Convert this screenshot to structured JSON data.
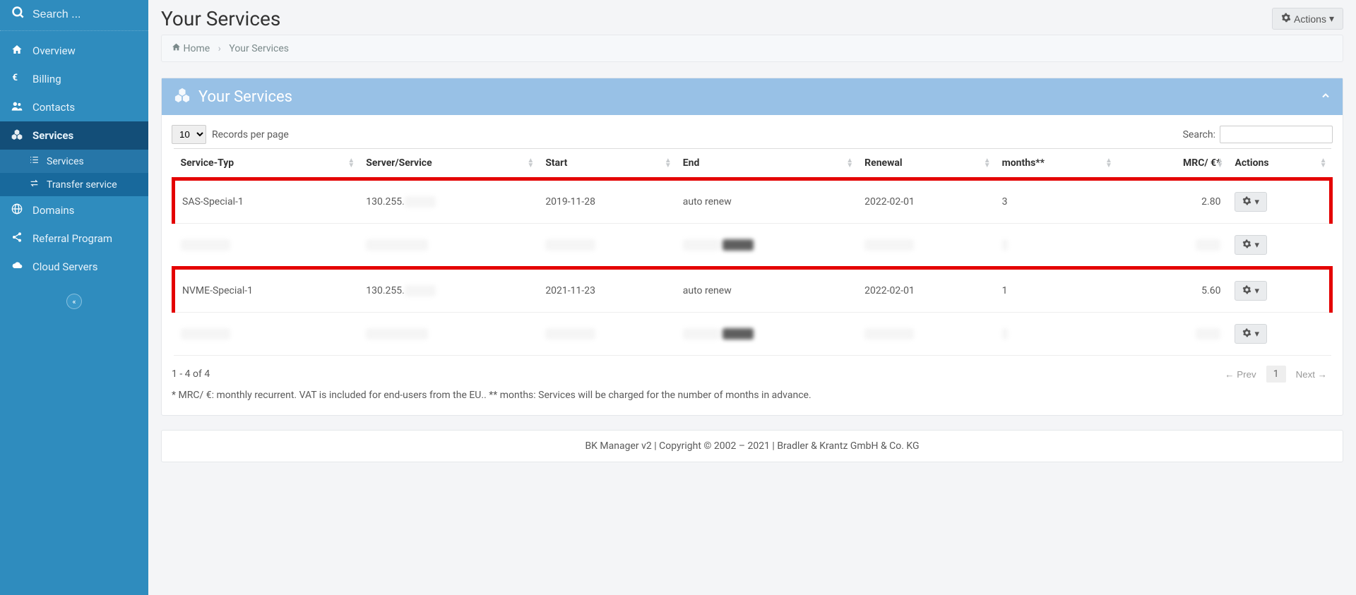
{
  "search": {
    "placeholder": "Search ..."
  },
  "nav": {
    "overview": "Overview",
    "billing": "Billing",
    "contacts": "Contacts",
    "services": "Services",
    "sub_services": "Services",
    "sub_transfer": "Transfer service",
    "domains": "Domains",
    "referral": "Referral Program",
    "cloud": "Cloud Servers"
  },
  "header": {
    "title": "Your Services",
    "actions_label": "Actions",
    "breadcrumb_home": "Home",
    "breadcrumb_current": "Your Services"
  },
  "panel": {
    "title": "Your Services"
  },
  "controls": {
    "page_size_options": [
      "10"
    ],
    "page_size_selected": "10",
    "records_label": "Records per page",
    "search_label": "Search:"
  },
  "columns": {
    "service_type": "Service-Typ",
    "server": "Server/Service",
    "start": "Start",
    "end": "End",
    "renewal": "Renewal",
    "months": "months**",
    "mrc": "MRC/ €*",
    "actions": "Actions"
  },
  "rows": [
    {
      "service_type": "SAS-Special-1",
      "server": "130.255.",
      "start": "2019-11-28",
      "end": "auto renew",
      "renewal": "2022-02-01",
      "months": "3",
      "mrc": "2.80",
      "highlight": true,
      "redacted": false
    },
    {
      "service_type": "",
      "server": "",
      "start": "",
      "end": "",
      "renewal": "",
      "months": "",
      "mrc": "",
      "highlight": false,
      "redacted": true
    },
    {
      "service_type": "NVME-Special-1",
      "server": "130.255.",
      "start": "2021-11-23",
      "end": "auto renew",
      "renewal": "2022-02-01",
      "months": "1",
      "mrc": "5.60",
      "highlight": true,
      "redacted": false
    },
    {
      "service_type": "",
      "server": "",
      "start": "",
      "end": "",
      "renewal": "",
      "months": "",
      "mrc": "",
      "highlight": false,
      "redacted": true
    }
  ],
  "pagination": {
    "showing": "1 - 4 of 4",
    "prev": "← Prev",
    "page": "1",
    "next": "Next →"
  },
  "footnote": "* MRC/ €: monthly recurrent. VAT is included for end-users from the EU.. ** months: Services will be charged for the number of months in advance.",
  "footer": "BK Manager v2 | Copyright © 2002 – 2021 | Bradler & Krantz GmbH & Co. KG"
}
